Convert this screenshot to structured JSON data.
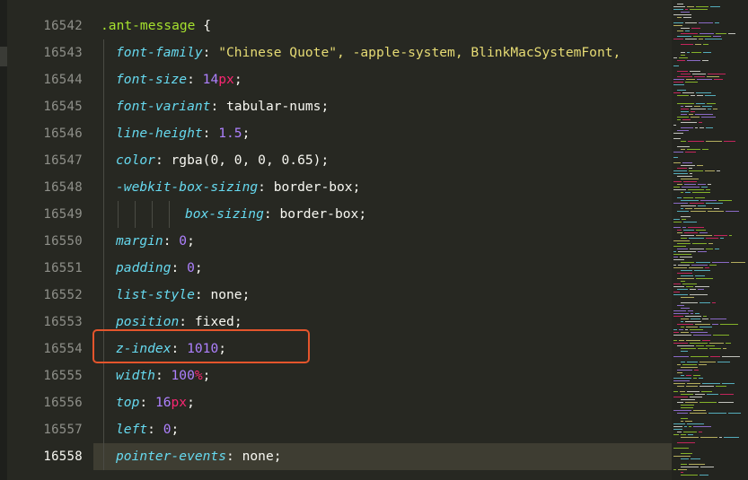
{
  "editor": {
    "line_numbers": [
      "16542",
      "16543",
      "16544",
      "16545",
      "16546",
      "16547",
      "16548",
      "16549",
      "16550",
      "16551",
      "16552",
      "16553",
      "16554",
      "16555",
      "16556",
      "16557",
      "16558"
    ],
    "current_line": "16558",
    "selector": ".ant-message",
    "open_brace": "{",
    "lines": [
      {
        "prop": "font-family",
        "value": "\"Chinese Quote\", -apple-system, BlinkMacSystemFont,"
      },
      {
        "prop": "font-size",
        "value": "14px"
      },
      {
        "prop": "font-variant",
        "value": "tabular-nums"
      },
      {
        "prop": "line-height",
        "value": "1.5"
      },
      {
        "prop": "color",
        "value": "rgba(0, 0, 0, 0.65)"
      },
      {
        "prop": "-webkit-box-sizing",
        "value": "border-box"
      },
      {
        "prop": "box-sizing",
        "value": "border-box"
      },
      {
        "prop": "margin",
        "value": "0"
      },
      {
        "prop": "padding",
        "value": "0"
      },
      {
        "prop": "list-style",
        "value": "none"
      },
      {
        "prop": "position",
        "value": "fixed"
      },
      {
        "prop": "z-index",
        "value": "1010"
      },
      {
        "prop": "width",
        "value": "100%"
      },
      {
        "prop": "top",
        "value": "16px"
      },
      {
        "prop": "left",
        "value": "0"
      },
      {
        "prop": "pointer-events",
        "value": "none"
      }
    ]
  },
  "annotation": {
    "highlighted_line": "16554",
    "color": "#e4552c"
  },
  "colors": {
    "background": "#272822",
    "property": "#66d9ef",
    "selector": "#a6e22e",
    "number": "#ae81ff",
    "unit": "#f92672",
    "string": "#e6db74"
  }
}
